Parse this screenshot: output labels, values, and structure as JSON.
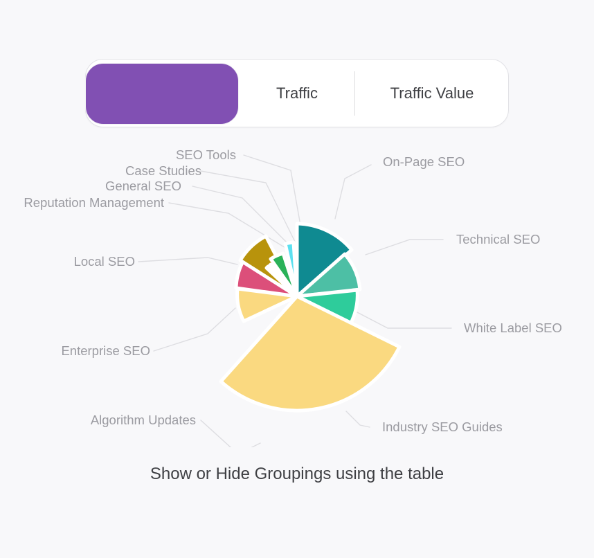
{
  "page": {
    "background_color": "#f8f8fa",
    "caption": "Show or Hide Groupings using the table"
  },
  "toggle": {
    "accent_color": "#8150b3",
    "segments": [
      {
        "label": "",
        "selected": true,
        "name": "toggle-selected"
      },
      {
        "label": "Traffic",
        "selected": false,
        "name": "toggle-traffic"
      },
      {
        "label": "Traffic Value",
        "selected": false,
        "name": "toggle-traffic-value"
      }
    ]
  },
  "chart_data": {
    "type": "pie",
    "title": "",
    "subtitle": "",
    "xlabel": "",
    "ylabel": "",
    "legend_position": "labels-with-leader-lines",
    "grid": false,
    "leader_line_color": "#dddde1",
    "label_color": "#9b9ba1",
    "categories": [
      "On-Page SEO",
      "Technical SEO",
      "White Label SEO",
      "Industry SEO Guides",
      "Algorithm Updates",
      "Enterprise SEO",
      "Local SEO",
      "Reputation Management",
      "General SEO",
      "Case Studies",
      "SEO Tools"
    ],
    "values": [
      13.5,
      9.0,
      7.5,
      31.0,
      9.5,
      9.0,
      9.5,
      0.4,
      0.4,
      4.2,
      6.0
    ],
    "colors": [
      "#0f8a91",
      "#4dbfa5",
      "#2ecc9b",
      "#fad980",
      "#fad980",
      "#dc4f7a",
      "#b8930c",
      "#27ae60",
      "#27ae60",
      "#2ab259",
      "#5ce0f0"
    ],
    "slices": [
      {
        "label": "On-Page SEO",
        "value": 13.5,
        "color": "#0f8a91",
        "radius": 105,
        "exploded": false
      },
      {
        "label": "Technical SEO",
        "value": 9.0,
        "color": "#4dbfa5",
        "radius": 92,
        "exploded": false
      },
      {
        "label": "White Label SEO",
        "value": 7.5,
        "color": "#2ecc9b",
        "radius": 88,
        "exploded": false
      },
      {
        "label": "Industry SEO Guides",
        "value": 31.0,
        "color": "#fad980",
        "radius": 165,
        "exploded": false
      },
      {
        "label": "Algorithm Updates",
        "value": 9.5,
        "color": "#fad980",
        "radius": 85,
        "exploded": false
      },
      {
        "label": "Enterprise SEO",
        "value": 9.0,
        "color": "#dc4f7a",
        "radius": 88,
        "exploded": false
      },
      {
        "label": "Local SEO",
        "value": 9.5,
        "color": "#b8930c",
        "radius": 95,
        "exploded": false
      },
      {
        "label": "Reputation Management",
        "value": 0.4,
        "color": "#27ae60",
        "radius": 60,
        "exploded": false
      },
      {
        "label": "General SEO",
        "value": 0.4,
        "color": "#27ae60",
        "radius": 60,
        "exploded": false
      },
      {
        "label": "Case Studies",
        "value": 4.2,
        "color": "#2ab259",
        "radius": 66,
        "exploded": false
      },
      {
        "label": "SEO Tools",
        "value": 6.0,
        "color": "#5ce0f0",
        "radius": 78,
        "exploded": false
      }
    ]
  },
  "labels": {
    "on_page_seo": "On-Page SEO",
    "technical_seo": "Technical SEO",
    "white_label_seo": "White Label SEO",
    "industry_seo_guides": "Industry SEO Guides",
    "algorithm_updates": "Algorithm Updates",
    "enterprise_seo": "Enterprise SEO",
    "local_seo": "Local SEO",
    "reputation_management": "Reputation Management",
    "general_seo": "General SEO",
    "case_studies": "Case Studies",
    "seo_tools": "SEO Tools"
  }
}
